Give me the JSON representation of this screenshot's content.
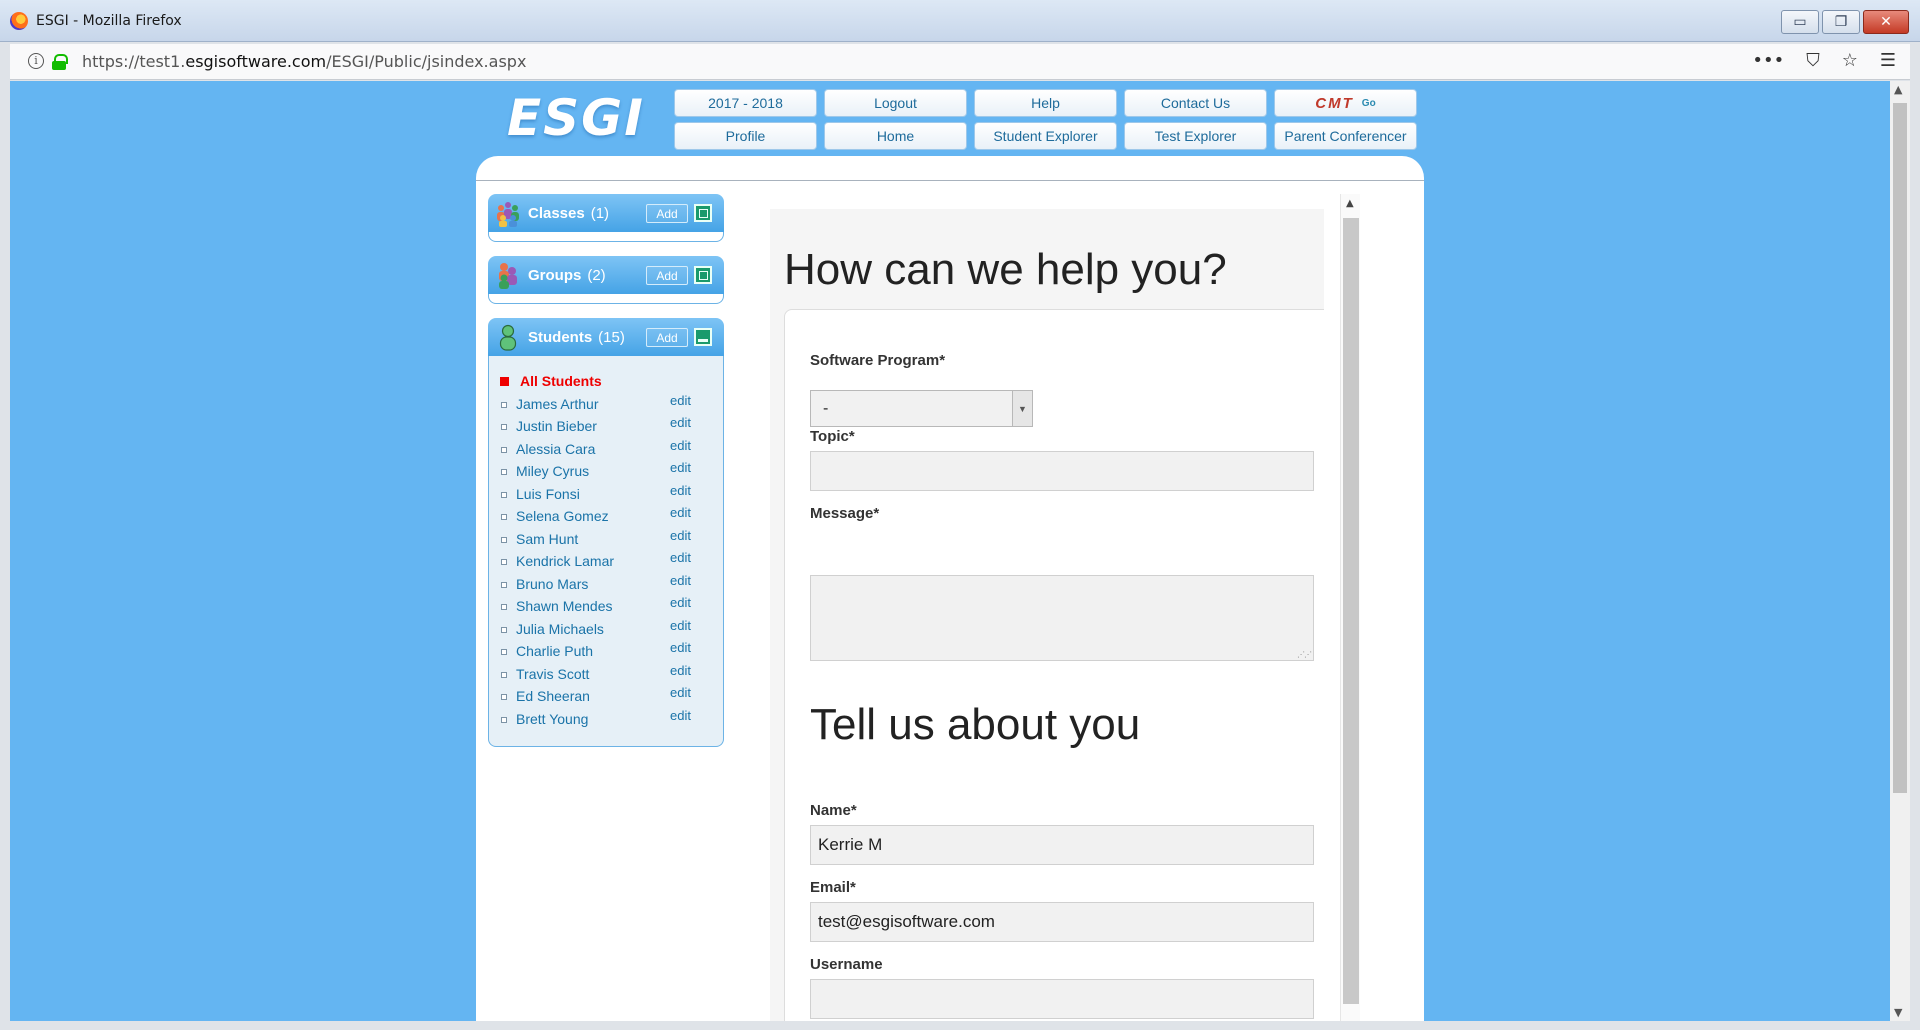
{
  "window": {
    "title": "ESGI - Mozilla Firefox",
    "min_symbol": "▭",
    "max_symbol": "❐",
    "close_symbol": "✕"
  },
  "browser": {
    "url_prefix": "https://test1.",
    "url_domain": "esgisoftware.com",
    "url_path": "/ESGI/Public/jsindex.aspx",
    "info_symbol": "i",
    "menu_dots": "•••",
    "pocket_symbol": "⛉",
    "star_symbol": "☆",
    "hamburger_symbol": "☰"
  },
  "site": {
    "logo": "ESGI",
    "nav": {
      "year": "2017 - 2018",
      "logout": "Logout",
      "help": "Help",
      "contact": "Contact Us",
      "cmt": "CMT",
      "cmt_go": "Go",
      "profile": "Profile",
      "home": "Home",
      "student_explorer": "Student Explorer",
      "test_explorer": "Test Explorer",
      "parent_conferencer": "Parent Conferencer"
    }
  },
  "sidebar": {
    "classes": {
      "label": "Classes",
      "count": "(1)",
      "add": "Add"
    },
    "groups": {
      "label": "Groups",
      "count": "(2)",
      "add": "Add"
    },
    "students": {
      "label": "Students",
      "count": "(15)",
      "add": "Add",
      "all_label": "All Students",
      "edit_label": "edit",
      "items": [
        "James Arthur",
        "Justin Bieber",
        "Alessia Cara",
        "Miley Cyrus",
        "Luis Fonsi",
        "Selena Gomez",
        "Sam Hunt",
        "Kendrick Lamar",
        "Bruno Mars",
        "Shawn Mendes",
        "Julia Michaels",
        "Charlie Puth",
        "Travis Scott",
        "Ed Sheeran",
        "Brett Young"
      ]
    }
  },
  "form": {
    "heading": "How can we help you?",
    "software_label": "Software Program*",
    "software_value": "-",
    "topic_label": "Topic*",
    "topic_value": "",
    "message_label": "Message*",
    "message_value": "",
    "about_heading": "Tell us about you",
    "name_label": "Name*",
    "name_value": "Kerrie M",
    "email_label": "Email*",
    "email_value": "test@esgisoftware.com",
    "username_label": "Username"
  },
  "colors": {
    "page_background": "#64b5f2",
    "sidebar_header": "#45a3e6",
    "link": "#1a73a8",
    "active_red": "#ee0000"
  }
}
